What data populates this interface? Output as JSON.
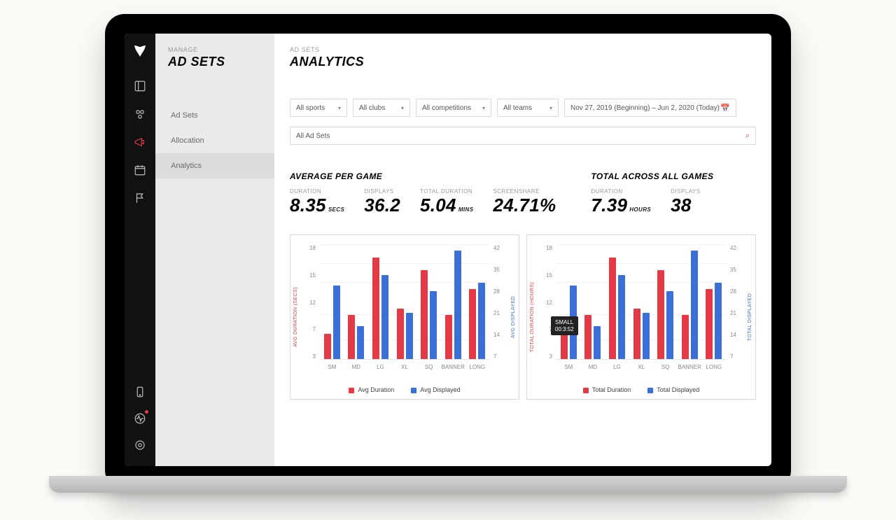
{
  "sidepanel": {
    "eyebrow": "MANAGE",
    "title": "AD SETS",
    "items": [
      {
        "label": "Ad Sets",
        "active": false
      },
      {
        "label": "Allocation",
        "active": false
      },
      {
        "label": "Analytics",
        "active": true
      }
    ]
  },
  "main": {
    "eyebrow": "AD SETS",
    "title": "ANALYTICS"
  },
  "filters": {
    "sport": "All sports",
    "club": "All clubs",
    "competition": "All competitions",
    "team": "All teams",
    "daterange": "Nov 27, 2019 (Beginning) – Jun 2, 2020 (Today)",
    "adsets_search": "All Ad Sets"
  },
  "stats_avg": {
    "header": "AVERAGE PER GAME",
    "duration": {
      "label": "DURATION",
      "value": "8.35",
      "unit": "SECS"
    },
    "displays": {
      "label": "DISPLAYS",
      "value": "36.2",
      "unit": ""
    },
    "total_duration": {
      "label": "TOTAL DURATION",
      "value": "5.04",
      "unit": "MINS"
    },
    "screenshare": {
      "label": "SCREENSHARE",
      "value": "24.71%",
      "unit": ""
    }
  },
  "stats_total": {
    "header": "TOTAL ACROSS ALL GAMES",
    "duration": {
      "label": "DURATION",
      "value": "7.39",
      "unit": "HOURS"
    },
    "displays": {
      "label": "DISPLAYS",
      "value": "38",
      "unit": ""
    }
  },
  "chart_data": [
    {
      "type": "bar",
      "title": "",
      "categories": [
        "SM",
        "MD",
        "LG",
        "XL",
        "SQ",
        "BANNER",
        "LONG"
      ],
      "y_left": {
        "label": "AVG DURATION (SECS)",
        "ticks": [
          3,
          7,
          12,
          15,
          18
        ],
        "range": [
          0,
          18
        ]
      },
      "y_right": {
        "label": "AVG DISPLAYED",
        "ticks": [
          7,
          14,
          21,
          28,
          35,
          42
        ],
        "range": [
          0,
          42
        ]
      },
      "series": [
        {
          "name": "Avg Duration",
          "axis": "left",
          "color": "#e63946",
          "values": [
            4,
            7,
            16,
            8,
            14,
            7,
            11
          ]
        },
        {
          "name": "Avg Displayed",
          "axis": "right",
          "color": "#3a6fd8",
          "values": [
            27,
            12,
            31,
            17,
            25,
            40,
            28
          ]
        }
      ],
      "legend": [
        "Avg Duration",
        "Avg Displayed"
      ]
    },
    {
      "type": "bar",
      "title": "",
      "categories": [
        "SM",
        "MD",
        "LG",
        "XL",
        "SQ",
        "BANNER",
        "LONG"
      ],
      "y_left": {
        "label": "TOTAL DURATION (HOURS)",
        "ticks": [
          3,
          7,
          12,
          15,
          18
        ],
        "range": [
          0,
          18
        ]
      },
      "y_right": {
        "label": "TOTAL DISPLAYED",
        "ticks": [
          7,
          14,
          21,
          28,
          35,
          42
        ],
        "range": [
          0,
          42
        ]
      },
      "series": [
        {
          "name": "Total Duration",
          "axis": "left",
          "color": "#e63946",
          "values": [
            4,
            7,
            16,
            8,
            14,
            7,
            11
          ]
        },
        {
          "name": "Total Displayed",
          "axis": "right",
          "color": "#3a6fd8",
          "values": [
            27,
            12,
            31,
            17,
            25,
            40,
            28
          ]
        }
      ],
      "legend": [
        "Total Duration",
        "Total Displayed"
      ],
      "tooltip": {
        "category": "SM",
        "line1": "SMALL",
        "line2": "00:3:52"
      }
    }
  ]
}
